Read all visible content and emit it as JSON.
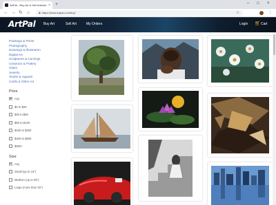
{
  "browser": {
    "tab_title": "ArtPal - Buy Art & Sell Artwork O...",
    "tab_close": "×",
    "new_tab": "+",
    "url": "https://www.artpal.com/buy/",
    "window_controls": [
      "–",
      "□",
      "×"
    ]
  },
  "site": {
    "logo": "ArtPal",
    "nav": [
      "Buy Art",
      "Sell Art",
      "My Orders"
    ],
    "login": "Login",
    "cart": "Cart",
    "brand_color": "#0f2234",
    "accent_color": "#f0a020"
  },
  "sidebar": {
    "categories": [
      "Paintings & Prints",
      "Photography",
      "Drawings & Illustration",
      "Digital Art",
      "Sculptures & Carvings",
      "Ceramics & Pottery",
      "Glass",
      "Jewelry",
      "Textile & Apparel",
      "Crafts & Other Art"
    ],
    "price": {
      "title": "Price",
      "options": [
        {
          "label": "Any",
          "checked": true
        },
        {
          "label": "$0 to $20",
          "checked": false
        },
        {
          "label": "$20 to $50",
          "checked": false
        },
        {
          "label": "$50 to $100",
          "checked": false
        },
        {
          "label": "$100 to $200",
          "checked": false
        },
        {
          "label": "$200 to $500",
          "checked": false
        },
        {
          "label": "$500+",
          "checked": false
        }
      ]
    },
    "size": {
      "title": "Size",
      "options": [
        {
          "label": "Any",
          "checked": true
        },
        {
          "label": "Small (up to 15\")",
          "checked": false
        },
        {
          "label": "Medium (up to 30\")",
          "checked": false
        },
        {
          "label": "Large (more than 30\")",
          "checked": false
        }
      ]
    }
  },
  "artworks": [
    {
      "subject": "tree painting"
    },
    {
      "subject": "portrait of man with hand on chin"
    },
    {
      "subject": "white flowers"
    },
    {
      "subject": "sailboat watercolor"
    },
    {
      "subject": "lotus flower"
    },
    {
      "subject": "abstract painting"
    },
    {
      "subject": "girl on stairs drawing"
    },
    {
      "subject": "red vintage car"
    },
    {
      "subject": "city skyline reflection"
    }
  ]
}
